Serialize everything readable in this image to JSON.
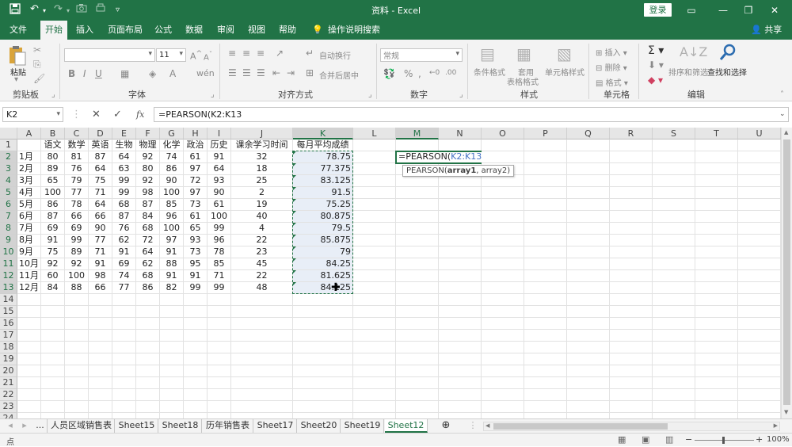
{
  "titlebar": {
    "title": "资料  -  Excel",
    "login": "登录",
    "icons": [
      "save-icon",
      "undo-icon",
      "redo-icon",
      "camera-icon",
      "print-preview-icon",
      "customize-icon"
    ],
    "window_buttons": [
      "ribbon-display-icon",
      "minimize-icon",
      "restore-icon",
      "close-icon"
    ]
  },
  "tabs": [
    "文件",
    "开始",
    "插入",
    "页面布局",
    "公式",
    "数据",
    "审阅",
    "视图",
    "帮助",
    "操作说明搜索"
  ],
  "active_tab": "开始",
  "share": "共享",
  "ribbon": {
    "clipboard": {
      "paste": "粘贴",
      "label": "剪贴板"
    },
    "font": {
      "name": "",
      "size": "11",
      "label": "字体"
    },
    "alignment": {
      "wrap": "自动换行",
      "merge": "合并后居中",
      "label": "对齐方式"
    },
    "number": {
      "format": "常规",
      "label": "数字"
    },
    "styles": {
      "cond": "条件格式",
      "table1": "套用",
      "table2": "表格格式",
      "cell": "单元格样式",
      "label": "样式"
    },
    "cells": {
      "insert": "插入",
      "delete": "删除",
      "format": "格式",
      "label": "单元格"
    },
    "editing": {
      "sort": "排序和筛选",
      "find": "查找和选择",
      "label": "编辑"
    }
  },
  "formula_bar": {
    "name_box": "K2",
    "formula": "=PEARSON(K2:K13",
    "fx": "fx"
  },
  "columns": [
    "A",
    "B",
    "C",
    "D",
    "E",
    "F",
    "G",
    "H",
    "I",
    "J",
    "K",
    "L",
    "M",
    "N",
    "O",
    "P",
    "Q",
    "R",
    "S",
    "T",
    "U"
  ],
  "header_row": [
    "",
    "语文",
    "数学",
    "英语",
    "生物",
    "物理",
    "化学",
    "政治",
    "历史",
    "课余学习时间",
    "每月平均成绩"
  ],
  "rows": [
    [
      "1月",
      "80",
      "81",
      "87",
      "64",
      "92",
      "74",
      "61",
      "91",
      "32",
      "78.75"
    ],
    [
      "2月",
      "89",
      "76",
      "64",
      "63",
      "80",
      "86",
      "97",
      "64",
      "18",
      "77.375"
    ],
    [
      "3月",
      "65",
      "79",
      "75",
      "99",
      "92",
      "90",
      "72",
      "93",
      "25",
      "83.125"
    ],
    [
      "4月",
      "100",
      "77",
      "71",
      "99",
      "98",
      "100",
      "97",
      "90",
      "2",
      "91.5"
    ],
    [
      "5月",
      "86",
      "78",
      "64",
      "68",
      "87",
      "85",
      "73",
      "61",
      "19",
      "75.25"
    ],
    [
      "6月",
      "87",
      "66",
      "66",
      "87",
      "84",
      "96",
      "61",
      "100",
      "40",
      "80.875"
    ],
    [
      "7月",
      "69",
      "69",
      "90",
      "76",
      "68",
      "100",
      "65",
      "99",
      "4",
      "79.5"
    ],
    [
      "8月",
      "91",
      "99",
      "77",
      "62",
      "72",
      "97",
      "93",
      "96",
      "22",
      "85.875"
    ],
    [
      "9月",
      "75",
      "89",
      "71",
      "91",
      "64",
      "91",
      "73",
      "78",
      "23",
      "79"
    ],
    [
      "10月",
      "92",
      "92",
      "91",
      "69",
      "62",
      "88",
      "95",
      "85",
      "45",
      "84.25"
    ],
    [
      "11月",
      "60",
      "100",
      "98",
      "74",
      "68",
      "91",
      "91",
      "71",
      "22",
      "81.625"
    ],
    [
      "12月",
      "84",
      "88",
      "66",
      "77",
      "86",
      "82",
      "99",
      "99",
      "48",
      "84.125"
    ]
  ],
  "row_numbers": [
    "1",
    "2",
    "3",
    "4",
    "5",
    "6",
    "7",
    "8",
    "9",
    "10",
    "11",
    "12",
    "13",
    "14",
    "15",
    "16",
    "17",
    "18",
    "19",
    "20",
    "21",
    "22",
    "23",
    "24"
  ],
  "edit_cell": {
    "prefix": "=PEARSON(",
    "ref": "K2:K13"
  },
  "tooltip": {
    "fn": "PEARSON(",
    "arg1": "array1",
    "rest": ", array2)"
  },
  "sheets": [
    "...",
    "人员区域销售表",
    "Sheet15",
    "Sheet18",
    "历年销售表",
    "Sheet17",
    "Sheet20",
    "Sheet19",
    "Sheet12"
  ],
  "active_sheet": "Sheet12",
  "status": {
    "mode": "点",
    "zoom": "100%"
  },
  "colors": {
    "accent": "#217346",
    "ref": "#4472c4"
  }
}
